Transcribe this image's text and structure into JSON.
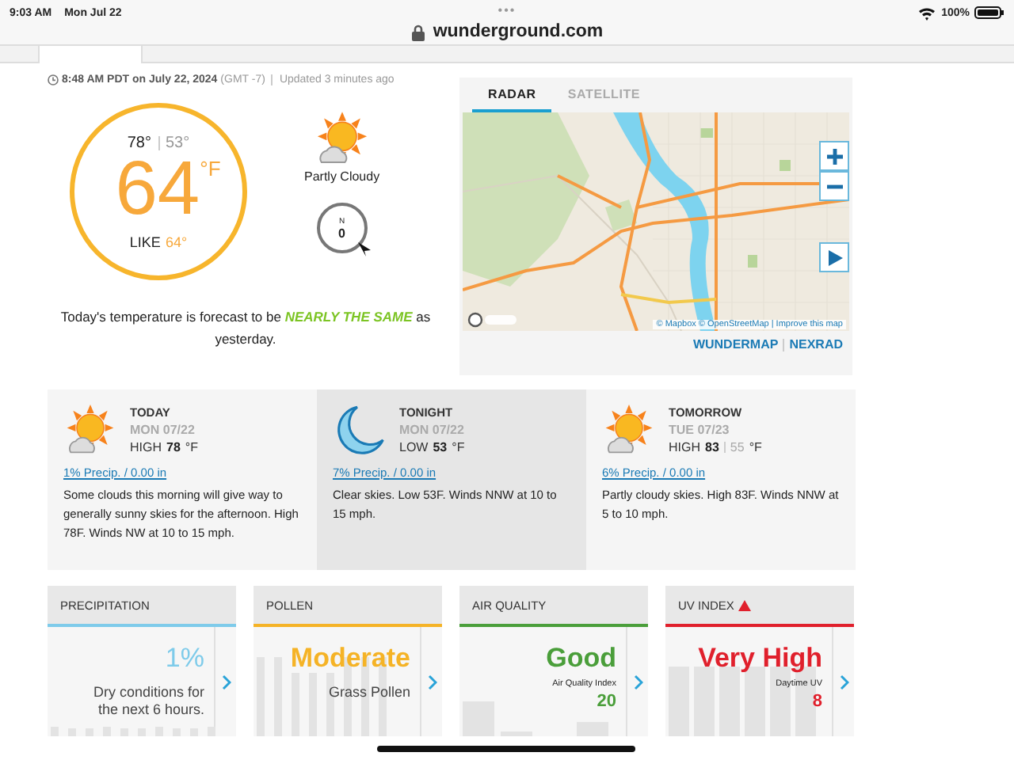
{
  "status_bar": {
    "time": "9:03 AM",
    "date": "Mon Jul 22",
    "dots": "•••",
    "url": "wunderground.com",
    "battery": "100%"
  },
  "current": {
    "observed": "8:48 AM PDT on July 22, 2024",
    "timezone": "(GMT -7)",
    "updated": "Updated 3 minutes ago",
    "high": "78°",
    "low": "53°",
    "temp": "64",
    "unit": "°F",
    "feels_label": "LIKE",
    "feels": "64°",
    "condition": "Partly Cloudy",
    "wind_dir": "N",
    "wind_speed": "0",
    "summary": "Today's temperature is forecast to be **NEARLY THE SAME** as yesterday."
  },
  "map": {
    "tabs": [
      {
        "label": "RADAR",
        "selected": true
      },
      {
        "label": "SATELLITE",
        "selected": false
      }
    ],
    "attribution": "© Mapbox © OpenStreetMap | Improve this map",
    "links": [
      "WUNDERMAP",
      "NEXRAD"
    ]
  },
  "forecast": [
    {
      "kind": "partly-cloudy",
      "period": "TODAY",
      "date": "MON 07/22",
      "temp_label": "HIGH",
      "temp": "78",
      "unit": "°F",
      "precip": "1% Precip. / 0.00 in",
      "text": "Some clouds this morning will give way to generally sunny skies for the afternoon. High 78F. Winds NW at 10 to 15 mph.",
      "selected": false
    },
    {
      "kind": "moon",
      "period": "TONIGHT",
      "date": "MON 07/22",
      "temp_label": "LOW",
      "temp": "53",
      "unit": "°F",
      "precip": "7% Precip. / 0.00 in",
      "text": "Clear skies. Low 53F. Winds NNW at 10 to 15 mph.",
      "selected": true
    },
    {
      "kind": "partly-cloudy",
      "period": "TOMORROW",
      "date": "TUE 07/23",
      "temp_label": "HIGH",
      "temp": "83",
      "low": "55",
      "unit": "°F",
      "precip": "6% Precip. / 0.00 in",
      "text": "Partly cloudy skies. High 83F. Winds NNW at 5 to 10 mph.",
      "selected": false
    }
  ],
  "cards": [
    {
      "kind": "text",
      "title": "PRECIPITATION",
      "color": "#7ecbea",
      "value": "1%",
      "detail": "Dry conditions for the next 6 hours.",
      "alert": false
    },
    {
      "kind": "text",
      "title": "POLLEN",
      "color": "#f5b326",
      "value": "Moderate",
      "detail": "Grass Pollen",
      "alert": false
    },
    {
      "kind": "index",
      "title": "AIR QUALITY",
      "color": "#4a9e3a",
      "value": "Good",
      "label": "Air Quality Index",
      "index": "20",
      "alert": false
    },
    {
      "kind": "index",
      "title": "UV INDEX",
      "color": "#e0202c",
      "value": "Very High",
      "label": "Daytime UV",
      "index": "8",
      "alert": true
    }
  ]
}
